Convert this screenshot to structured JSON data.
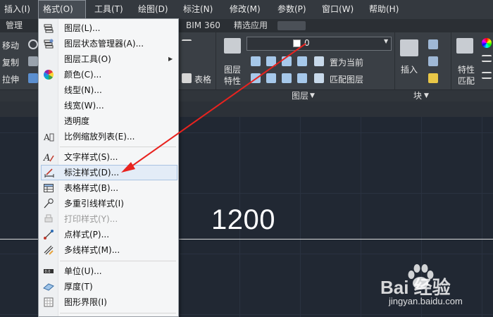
{
  "menubar": {
    "items": [
      {
        "label": "插入(I)"
      },
      {
        "label": "格式(O)"
      },
      {
        "label": "工具(T)"
      },
      {
        "label": "绘图(D)"
      },
      {
        "label": "标注(N)"
      },
      {
        "label": "修改(M)"
      },
      {
        "label": "参数(P)"
      },
      {
        "label": "窗口(W)"
      },
      {
        "label": "帮助(H)"
      }
    ]
  },
  "tabs": {
    "items": [
      {
        "label": "管理"
      },
      {
        "label": "BIM 360"
      },
      {
        "label": "精选应用"
      }
    ]
  },
  "ribbon": {
    "left_tools": {
      "move": "移动",
      "copy": "复制",
      "stretch": "拉伸"
    },
    "table": "表格",
    "layer_props": {
      "line1": "图层",
      "line2": "特性"
    },
    "layer_combo_value": "0",
    "set_current": "置为当前",
    "match_layer": "匹配图层",
    "insert": "插入",
    "props": {
      "line1": "特性",
      "line2": "匹配"
    },
    "panels": {
      "layers": "图层",
      "block": "块"
    }
  },
  "canvas": {
    "dimension_text": "1200"
  },
  "format_menu": {
    "items": [
      {
        "label": "图层(L)...",
        "icon": "layers-icon"
      },
      {
        "label": "图层状态管理器(A)...",
        "icon": "layer-state-icon"
      },
      {
        "label": "图层工具(O)",
        "icon": "none",
        "submenu": true
      },
      {
        "label": "颜色(C)...",
        "icon": "color-wheel-icon"
      },
      {
        "label": "线型(N)...",
        "icon": "none"
      },
      {
        "label": "线宽(W)...",
        "icon": "none"
      },
      {
        "label": "透明度",
        "icon": "none"
      },
      {
        "label": "比例缩放列表(E)...",
        "icon": "scale-list-icon"
      },
      {
        "label": "文字样式(S)...",
        "icon": "text-style-icon"
      },
      {
        "label": "标注样式(D)...",
        "icon": "dim-style-icon",
        "highlighted": true
      },
      {
        "label": "表格样式(B)...",
        "icon": "table-style-icon"
      },
      {
        "label": "多重引线样式(I)",
        "icon": "multileader-style-icon"
      },
      {
        "label": "打印样式(Y)...",
        "icon": "plot-style-icon",
        "disabled": true
      },
      {
        "label": "点样式(P)...",
        "icon": "point-style-icon"
      },
      {
        "label": "多线样式(M)...",
        "icon": "mline-style-icon"
      },
      {
        "label": "单位(U)...",
        "icon": "units-icon"
      },
      {
        "label": "厚度(T)",
        "icon": "thickness-icon"
      },
      {
        "label": "图形界限(I)",
        "icon": "limits-icon"
      }
    ]
  },
  "watermark": {
    "logo_text": "Bai 经验",
    "url": "jingyan.baidu.com"
  },
  "colors": {
    "accent_arrow": "#e8231f",
    "menu_bg": "#f5f6f7",
    "canvas_bg": "#212833"
  }
}
